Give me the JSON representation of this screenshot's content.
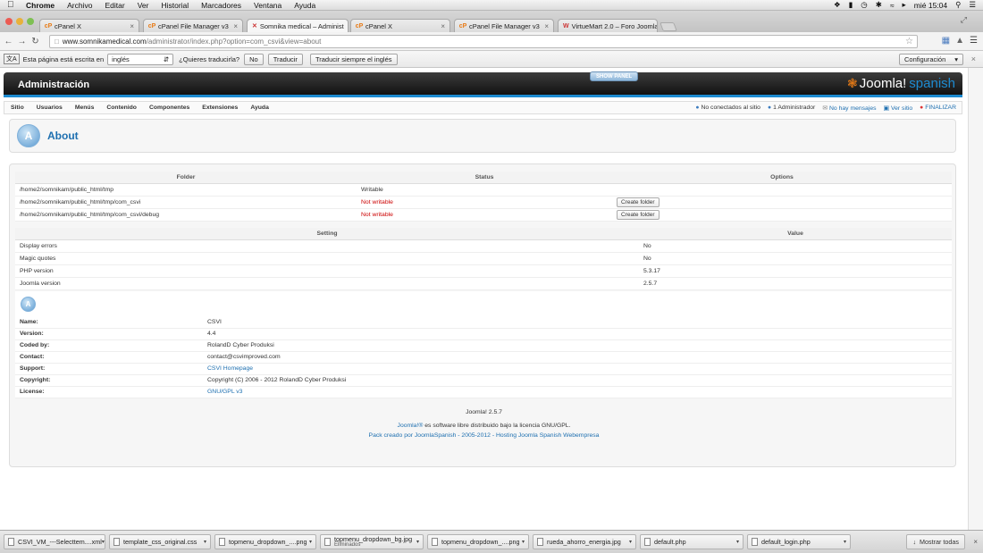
{
  "macbar": {
    "app": "Chrome",
    "menus": [
      "Archivo",
      "Editar",
      "Ver",
      "Historial",
      "Marcadores",
      "Ventana",
      "Ayuda"
    ],
    "clock": "mié 15:04"
  },
  "tabs": [
    {
      "label": "cPanel X",
      "icon": "cpanel-favicon"
    },
    {
      "label": "cPanel File Manager v3",
      "icon": "cpanel-favicon"
    },
    {
      "label": "Somnika medical – Administ",
      "icon": "joomla-favicon",
      "active": true
    },
    {
      "label": "cPanel X",
      "icon": "cpanel-favicon"
    },
    {
      "label": "cPanel File Manager v3",
      "icon": "cpanel-favicon"
    },
    {
      "label": "VirtueMart 2.0 – Foro Joomla",
      "icon": "virtuemart-favicon"
    }
  ],
  "address": {
    "host": "www.somnikamedical.com",
    "path": "/administrator/index.php?option=com_csvi&view=about"
  },
  "translate": {
    "prefix": "Esta página está escrita en",
    "language": "inglés",
    "question": "¿Quieres traducirla?",
    "no": "No",
    "translate": "Traducir",
    "always": "Traducir siempre el inglés",
    "config": "Configuración"
  },
  "admin": {
    "title": "Administración",
    "show_panel": "SHOW PANEL",
    "logo_word": "Joomla!",
    "logo_lang": "spanish"
  },
  "menu": {
    "items": [
      "Sitio",
      "Usuarios",
      "Menús",
      "Contenido",
      "Componentes",
      "Extensiones",
      "Ayuda"
    ],
    "status": {
      "online": "No conectados al sitio",
      "admins": "1 Administrador",
      "messages": "No hay mensajes",
      "view_site": "Ver sitio",
      "logout": "FINALIZAR"
    }
  },
  "page": {
    "title": "About"
  },
  "folders": {
    "headers": [
      "Folder",
      "Status",
      "Options"
    ],
    "rows": [
      {
        "path": "/home2/somnikam/public_html/tmp",
        "status": "Writable",
        "option": ""
      },
      {
        "path": "/home2/somnikam/public_html/tmp/com_csvi",
        "status": "Not writable",
        "option": "Create folder"
      },
      {
        "path": "/home2/somnikam/public_html/tmp/com_csvi/debug",
        "status": "Not writable",
        "option": "Create folder"
      }
    ]
  },
  "settings": {
    "headers": [
      "Setting",
      "Value"
    ],
    "rows": [
      {
        "name": "Display errors",
        "value": "No"
      },
      {
        "name": "Magic quotes",
        "value": "No"
      },
      {
        "name": "PHP version",
        "value": "5.3.17"
      },
      {
        "name": "Joomla version",
        "value": "2.5.7"
      }
    ]
  },
  "info": {
    "rows": [
      {
        "key": "Name:",
        "value": "CSVI"
      },
      {
        "key": "Version:",
        "value": "4.4"
      },
      {
        "key": "Coded by:",
        "value": "RolandD Cyber Produksi"
      },
      {
        "key": "Contact:",
        "value": "contact@csvimproved.com"
      },
      {
        "key": "Support:",
        "value": "CSVI Homepage",
        "link": true
      },
      {
        "key": "Copyright:",
        "value": "Copyright (C) 2006 - 2012 RolandD Cyber Produksi"
      },
      {
        "key": "License:",
        "value": "GNU/GPL v3",
        "link": true
      }
    ]
  },
  "footer": {
    "version": "Joomla! 2.5.7",
    "license_link": "Joomla!®",
    "license_text": " es software libre distribuido bajo la licencia GNU/GPL.",
    "pack": "Pack creado por JoomlaSpanish - 2005-2012 - Hosting Joomla Spanish Webempresa"
  },
  "downloads": {
    "items": [
      {
        "name": "CSVI_VM_---Selecttem....xml"
      },
      {
        "name": "template_css_original.css"
      },
      {
        "name": "topmenu_dropdown_....png"
      },
      {
        "name": "topmenu_dropdown_bg.jpg",
        "sub": "Eliminados"
      },
      {
        "name": "topmenu_dropdown_....png"
      },
      {
        "name": "rueda_ahorro_energia.jpg"
      },
      {
        "name": "default.php"
      },
      {
        "name": "default_login.php"
      }
    ],
    "show_all": "Mostrar todas"
  }
}
